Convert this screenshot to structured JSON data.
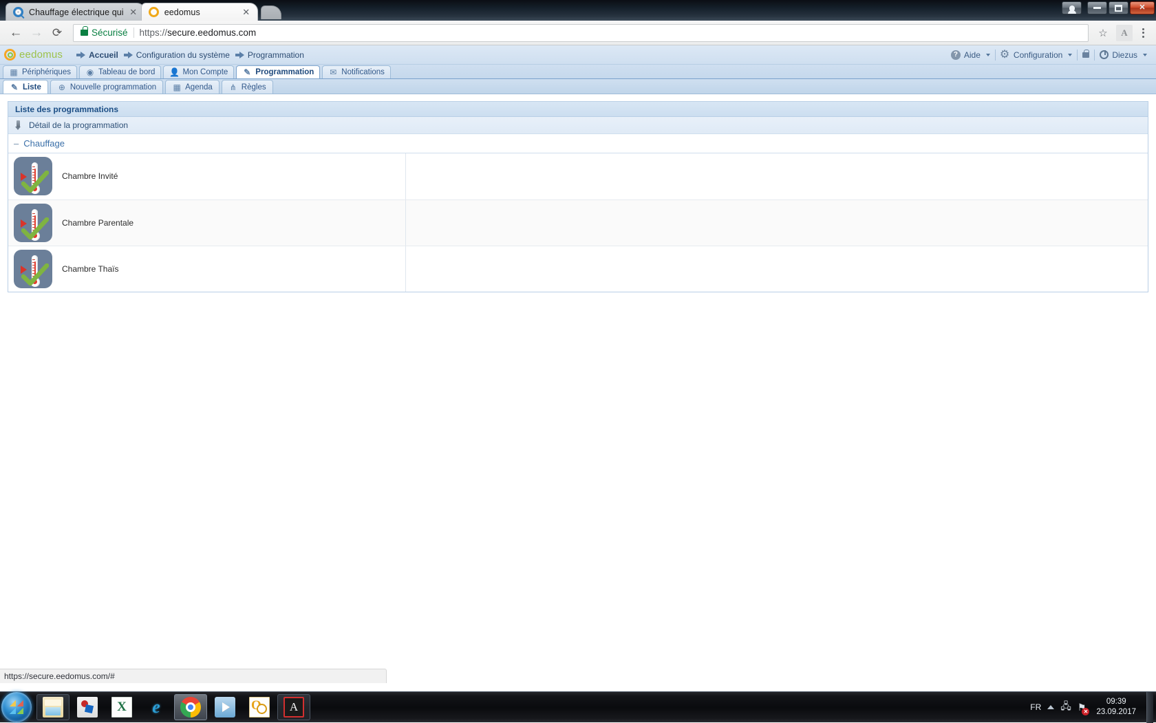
{
  "browser": {
    "tabs": [
      {
        "title": "Chauffage électrique qui",
        "favicon": "search-favicon",
        "active": false,
        "close": "✕"
      },
      {
        "title": "eedomus",
        "favicon": "eedomus-favicon",
        "active": true,
        "close": "✕"
      }
    ],
    "nav": {
      "back": "←",
      "forward": "→",
      "reload": "⟳"
    },
    "omnibox": {
      "security_label": "Sécurisé",
      "url_scheme": "https://",
      "url_rest": "secure.eedomus.com",
      "full_url": "https://secure.eedomus.com"
    },
    "star_icon": "☆",
    "extension_icon": "A",
    "menu_icon": "kebab-menu"
  },
  "window": {
    "controls": {
      "user": "person",
      "minimize": "—",
      "maximize": "❐",
      "close": "✕"
    }
  },
  "app": {
    "logo_text": "eedomus",
    "breadcrumbs": [
      {
        "label": "Accueil",
        "bold": true
      },
      {
        "label": "Configuration du système",
        "bold": false
      },
      {
        "label": "Programmation",
        "bold": false
      }
    ],
    "header_right": [
      {
        "label": "Aide",
        "icon": "help-icon",
        "caret": true
      },
      {
        "label": "Configuration",
        "icon": "gear-icon",
        "caret": true
      },
      {
        "label": "",
        "icon": "lock-icon",
        "caret": false
      },
      {
        "label": "Diezus",
        "icon": "power-icon",
        "caret": true
      }
    ],
    "main_tabs": [
      {
        "label": "Périphériques",
        "icon": "devices-icon",
        "active": false
      },
      {
        "label": "Tableau de bord",
        "icon": "dashboard-icon",
        "active": false
      },
      {
        "label": "Mon Compte",
        "icon": "user-icon",
        "active": false
      },
      {
        "label": "Programmation",
        "icon": "wand-icon",
        "active": true
      },
      {
        "label": "Notifications",
        "icon": "envelope-icon",
        "active": false
      }
    ],
    "sub_tabs": [
      {
        "label": "Liste",
        "icon": "wand-icon",
        "active": true
      },
      {
        "label": "Nouvelle programmation",
        "icon": "plus-icon",
        "active": false
      },
      {
        "label": "Agenda",
        "icon": "calendar-icon",
        "active": false
      },
      {
        "label": "Règles",
        "icon": "rules-icon",
        "active": false
      }
    ],
    "panel": {
      "title": "Liste des programmations",
      "subheader": "Détail de la programmation",
      "subheader_icon": "pencil-icon",
      "group": {
        "label": "Chauffage",
        "collapse_icon": "–"
      },
      "programs": [
        {
          "name": "Chambre Invité",
          "icon": "thermostat-program-icon"
        },
        {
          "name": "Chambre Parentale",
          "icon": "thermostat-program-icon"
        },
        {
          "name": "Chambre Thaïs",
          "icon": "thermostat-program-icon"
        }
      ]
    }
  },
  "statusbar": {
    "url": "https://secure.eedomus.com/#"
  },
  "taskbar": {
    "start": "start-orb",
    "items": [
      {
        "name": "windows-explorer",
        "running": false,
        "pinned": true
      },
      {
        "name": "paint-app",
        "running": false,
        "pinned": false
      },
      {
        "name": "microsoft-excel",
        "running": false,
        "pinned": false
      },
      {
        "name": "internet-explorer",
        "running": false,
        "pinned": false
      },
      {
        "name": "google-chrome",
        "running": true,
        "pinned": false
      },
      {
        "name": "windows-media-player",
        "running": false,
        "pinned": false
      },
      {
        "name": "microsoft-outlook",
        "running": false,
        "pinned": false
      },
      {
        "name": "adobe-reader",
        "running": false,
        "pinned": true
      }
    ],
    "tray": {
      "language": "FR",
      "network_badge": "✕",
      "time": "09:39",
      "date": "23.09.2017"
    }
  },
  "colors": {
    "app_header_bg": "#cfdff0",
    "panel_border": "#b9cfe6",
    "panel_title_text": "#1d4f86",
    "link_blue": "#3a6fa8",
    "tile_bg": "#6b7f99",
    "mercury_red": "#e23b2e",
    "check_green": "#7fb441",
    "secure_green": "#0b8043"
  }
}
